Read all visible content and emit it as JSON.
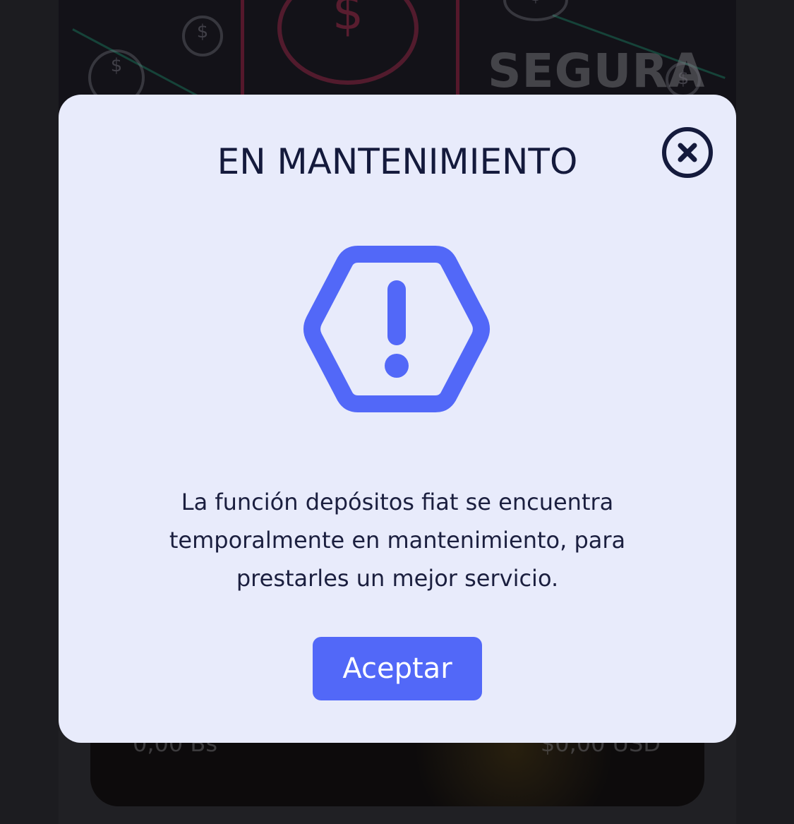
{
  "background": {
    "banner_text": "SEGURA",
    "card": {
      "amount_left": "0,00 Bs",
      "amount_right": "$0,00 USD"
    }
  },
  "modal": {
    "title": "EN MANTENIMIENTO",
    "icon": "warning-hexagon-icon",
    "close_icon": "close-circle-icon",
    "message": "La función depósitos fiat se encuentra temporalmente en mantenimiento, para prestarles un mejor servicio.",
    "accept_label": "Aceptar"
  },
  "colors": {
    "modal_background": "#e8ebfb",
    "accent": "#5268f8",
    "title_text": "#141a3c",
    "page_background": "#1c1c20"
  }
}
